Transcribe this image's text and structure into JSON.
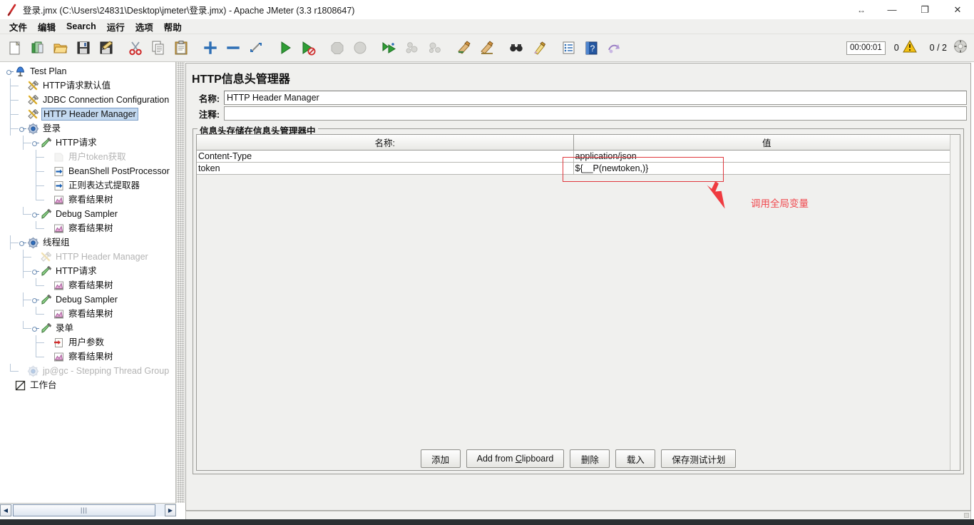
{
  "window": {
    "title": "登录.jmx (C:\\Users\\24831\\Desktop\\jmeter\\登录.jmx) - Apache JMeter (3.3 r1808647)",
    "app_icon": "jmeter-feather-icon",
    "controls": {
      "resize": "↔",
      "minimize": "—",
      "maximize": "❐",
      "close": "✕"
    }
  },
  "menubar": {
    "items": [
      {
        "label": "文件",
        "name": "menu-file"
      },
      {
        "label": "编辑",
        "name": "menu-edit"
      },
      {
        "label": "Search",
        "name": "menu-search"
      },
      {
        "label": "运行",
        "name": "menu-run"
      },
      {
        "label": "选项",
        "name": "menu-options"
      },
      {
        "label": "帮助",
        "name": "menu-help"
      }
    ]
  },
  "toolbar": {
    "buttons": [
      {
        "name": "new-icon",
        "title": "新建"
      },
      {
        "name": "templates-icon",
        "title": "模板"
      },
      {
        "name": "open-icon",
        "title": "打开"
      },
      {
        "name": "save-icon",
        "title": "保存"
      },
      {
        "name": "save-as-icon",
        "title": "另存为"
      },
      {
        "name": "cut-icon",
        "title": "剪切"
      },
      {
        "name": "copy-icon",
        "title": "复制"
      },
      {
        "name": "paste-icon",
        "title": "粘贴"
      },
      {
        "name": "expand-all-icon",
        "title": "展开全部"
      },
      {
        "name": "collapse-all-icon",
        "title": "折叠全部"
      },
      {
        "name": "toggle-icon",
        "title": "切换"
      },
      {
        "name": "start-icon",
        "title": "启动"
      },
      {
        "name": "start-no-timers-icon",
        "title": "无间隔启动"
      },
      {
        "name": "stop-icon",
        "title": "停止"
      },
      {
        "name": "shutdown-icon",
        "title": "关闭"
      },
      {
        "name": "start-remote-all-icon",
        "title": "远程启动所有"
      },
      {
        "name": "stop-remote-all-icon",
        "title": "远程停止所有"
      },
      {
        "name": "shutdown-remote-all-icon",
        "title": "远程关闭所有"
      },
      {
        "name": "clear-icon",
        "title": "清除"
      },
      {
        "name": "clear-all-icon",
        "title": "清除全部"
      },
      {
        "name": "search-icon",
        "title": "查找"
      },
      {
        "name": "search-reset-icon",
        "title": "重置查找"
      },
      {
        "name": "function-helper-icon",
        "title": "函数助手对话框"
      },
      {
        "name": "help-icon",
        "title": "帮助"
      },
      {
        "name": "undo-redo-icon",
        "title": "撤销"
      }
    ],
    "timer": "00:00:01",
    "warning_count": "0",
    "warning_icon": "warning-triangle-icon",
    "threads": "0 / 2",
    "remote_icon": "remote-engines-icon"
  },
  "tree": {
    "nodes": [
      {
        "label": "Test Plan",
        "indent": 0,
        "icon": "test-plan-icon",
        "handle": true,
        "selected": false,
        "disabled": false
      },
      {
        "label": "HTTP请求默认值",
        "indent": 1,
        "icon": "config-element-icon",
        "handle": false,
        "selected": false,
        "disabled": false
      },
      {
        "label": "JDBC Connection Configuration",
        "indent": 1,
        "icon": "config-element-icon",
        "handle": false,
        "selected": false,
        "disabled": false
      },
      {
        "label": "HTTP Header Manager",
        "indent": 1,
        "icon": "config-element-icon",
        "handle": false,
        "selected": true,
        "disabled": false
      },
      {
        "label": "登录",
        "indent": 1,
        "icon": "thread-group-icon",
        "handle": true,
        "selected": false,
        "disabled": false
      },
      {
        "label": "HTTP请求",
        "indent": 2,
        "icon": "sampler-icon",
        "handle": true,
        "selected": false,
        "disabled": false
      },
      {
        "label": "用户token获取",
        "indent": 3,
        "icon": "controller-icon",
        "handle": false,
        "selected": false,
        "disabled": true
      },
      {
        "label": "BeanShell PostProcessor",
        "indent": 3,
        "icon": "post-processor-icon",
        "handle": false,
        "selected": false,
        "disabled": false
      },
      {
        "label": "正则表达式提取器",
        "indent": 3,
        "icon": "post-processor-icon",
        "handle": false,
        "selected": false,
        "disabled": false
      },
      {
        "label": "察看结果树",
        "indent": 3,
        "icon": "listener-icon",
        "handle": false,
        "selected": false,
        "disabled": false
      },
      {
        "label": "Debug Sampler",
        "indent": 2,
        "icon": "sampler-icon",
        "handle": true,
        "selected": false,
        "disabled": false
      },
      {
        "label": "察看结果树",
        "indent": 3,
        "icon": "listener-icon",
        "handle": false,
        "selected": false,
        "disabled": false
      },
      {
        "label": "线程组",
        "indent": 1,
        "icon": "thread-group-icon",
        "handle": true,
        "selected": false,
        "disabled": false
      },
      {
        "label": "HTTP Header Manager",
        "indent": 2,
        "icon": "config-element-icon",
        "handle": false,
        "selected": false,
        "disabled": true
      },
      {
        "label": "HTTP请求",
        "indent": 2,
        "icon": "sampler-icon",
        "handle": true,
        "selected": false,
        "disabled": false
      },
      {
        "label": "察看结果树",
        "indent": 3,
        "icon": "listener-icon",
        "handle": false,
        "selected": false,
        "disabled": false
      },
      {
        "label": "Debug Sampler",
        "indent": 2,
        "icon": "sampler-icon",
        "handle": true,
        "selected": false,
        "disabled": false
      },
      {
        "label": "察看结果树",
        "indent": 3,
        "icon": "listener-icon",
        "handle": false,
        "selected": false,
        "disabled": false
      },
      {
        "label": "录单",
        "indent": 2,
        "icon": "sampler-icon",
        "handle": true,
        "selected": false,
        "disabled": false
      },
      {
        "label": "用户参数",
        "indent": 3,
        "icon": "user-parameters-icon",
        "handle": false,
        "selected": false,
        "disabled": false
      },
      {
        "label": "察看结果树",
        "indent": 3,
        "icon": "listener-icon",
        "handle": false,
        "selected": false,
        "disabled": false
      },
      {
        "label": "jp@gc - Stepping Thread Group",
        "indent": 1,
        "icon": "thread-group-icon",
        "handle": false,
        "selected": false,
        "disabled": true
      },
      {
        "label": "工作台",
        "indent": 0,
        "icon": "workbench-icon",
        "handle": false,
        "selected": false,
        "disabled": false
      }
    ],
    "hscroll": {
      "left_arrow": "◀",
      "right_arrow": "▶",
      "grip": "|||"
    }
  },
  "main": {
    "panel_title": "HTTP信息头管理器",
    "name_label": "名称:",
    "name_value": "HTTP Header Manager",
    "comment_label": "注释:",
    "comment_value": "",
    "group_legend": "信息头存储在信息头管理器中",
    "table": {
      "columns": [
        "名称:",
        "值"
      ],
      "rows": [
        {
          "name": "Content-Type",
          "value": "application/json"
        },
        {
          "name": "token",
          "value": "${__P(newtoken,)}"
        }
      ]
    },
    "annotation": {
      "text": "调用全局变量",
      "color": "#f0484e",
      "arrow_icon": "red-arrow-icon"
    },
    "buttons": [
      {
        "label": "添加",
        "name": "add-button",
        "mnemonic": ""
      },
      {
        "label": "Add from Clipboard",
        "name": "add-from-clipboard-button",
        "mnemonic": "C"
      },
      {
        "label": "删除",
        "name": "delete-button",
        "mnemonic": ""
      },
      {
        "label": "载入",
        "name": "load-button",
        "mnemonic": ""
      },
      {
        "label": "保存测试计划",
        "name": "save-test-plan-button",
        "mnemonic": ""
      }
    ]
  }
}
